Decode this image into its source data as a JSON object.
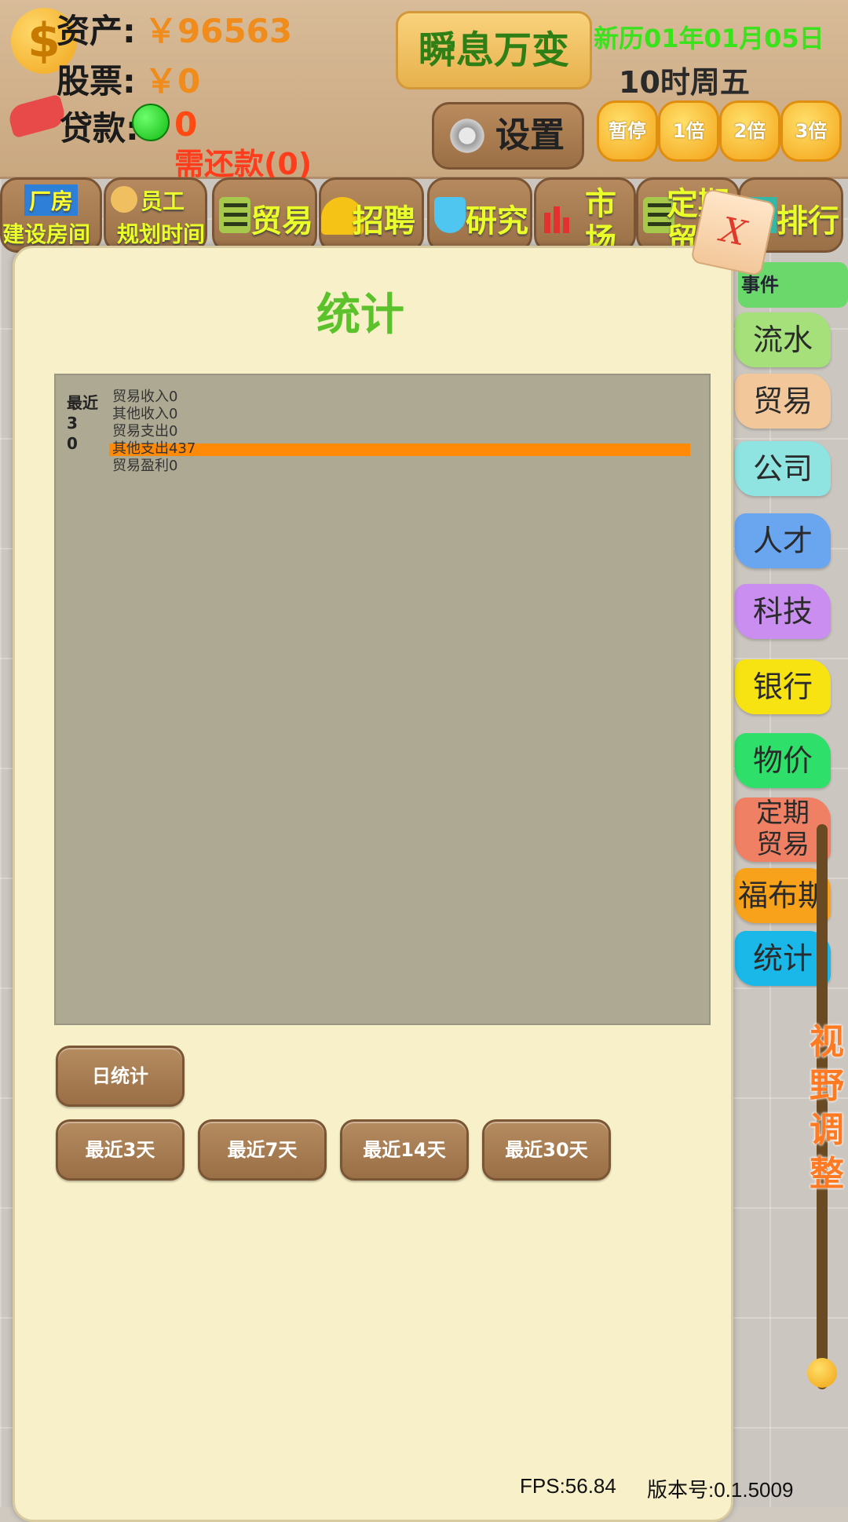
{
  "hud": {
    "assets_label": "资产:",
    "assets_value": "￥96563",
    "stocks_label": "股票:",
    "stocks_value": "￥0",
    "loan_label": "贷款:",
    "loan_value": "0",
    "repay_text": "需还款(0)",
    "game_title": "瞬息万变",
    "date_line": "新历01年01月05日",
    "time_line": "10时周五",
    "settings_label": "设置",
    "speed_buttons": [
      "暂停",
      "1倍",
      "2倍",
      "3倍"
    ]
  },
  "toolbar": {
    "factory_top": "厂房",
    "factory_bottom": "建设房间",
    "staff_top": "员工",
    "staff_bottom": "规划时间",
    "trade": "贸易",
    "recruit": "招聘",
    "research": "研究",
    "market_top": "市",
    "market_bottom": "场",
    "scheduled_top": "定期",
    "scheduled_bottom": "贸",
    "ranking": "排行"
  },
  "panel": {
    "title": "统计",
    "close_label": "X",
    "period_label": "最近30",
    "stats": [
      {
        "label": "贸易收入0",
        "value": 0
      },
      {
        "label": "其他收入0",
        "value": 0
      },
      {
        "label": "贸易支出0",
        "value": 0
      },
      {
        "label": "其他支出437",
        "value": 437
      },
      {
        "label": "贸易盈利0",
        "value": 0
      }
    ],
    "daily_button": "日统计",
    "range_buttons": [
      "最近3天",
      "最近7天",
      "最近14天",
      "最近30天"
    ]
  },
  "side_tabs": {
    "event": "事件",
    "items": [
      "流水",
      "贸易",
      "公司",
      "人才",
      "科技",
      "银行",
      "物价",
      "定期贸易",
      "福布斯",
      "统计"
    ],
    "colors": [
      "#a5e07a",
      "#f2c79a",
      "#8fe3e0",
      "#6aa6f0",
      "#c98ef0",
      "#f7e312",
      "#2ee06a",
      "#f08064",
      "#f7a21a",
      "#1ab8e8"
    ]
  },
  "zoom_label": "视野调整",
  "footer": {
    "fps": "FPS:56.84",
    "version": "版本号:0.1.5009"
  },
  "chart_data": {
    "type": "bar",
    "categories": [
      "贸易收入",
      "其他收入",
      "贸易支出",
      "其他支出",
      "贸易盈利"
    ],
    "values": [
      0,
      0,
      0,
      437,
      0
    ]
  }
}
